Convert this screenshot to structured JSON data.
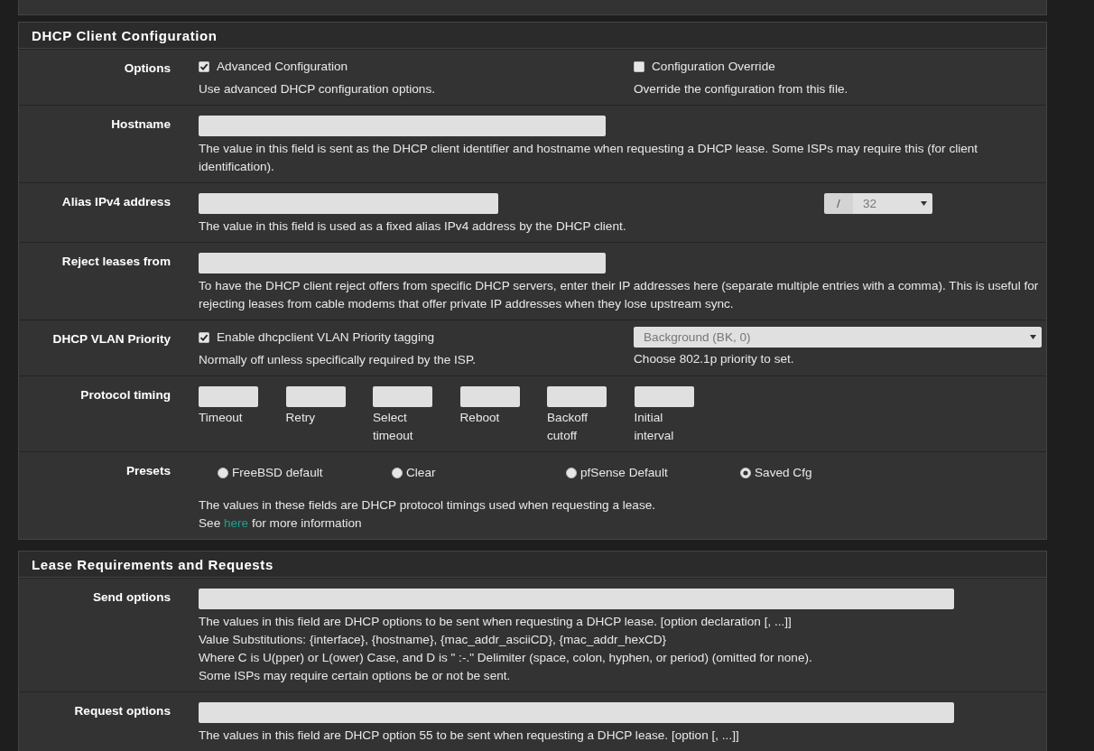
{
  "sections": [
    {
      "title": "DHCP Client Configuration",
      "rows": [
        {
          "kind": "options",
          "label": "Options",
          "checks": [
            {
              "label": "Advanced Configuration",
              "checked": true,
              "help": "Use advanced DHCP configuration options."
            },
            {
              "label": "Configuration Override",
              "checked": false,
              "help": "Override the configuration from this file."
            }
          ]
        },
        {
          "kind": "text",
          "label": "Hostname",
          "help": [
            "The value in this field is sent as the DHCP client identifier and hostname when requesting a DHCP lease. Some ISPs may require this (for client identification)."
          ]
        },
        {
          "kind": "address",
          "label": "Alias IPv4 address",
          "separator": "/",
          "cidr": "32",
          "help": [
            "The value in this field is used as a fixed alias IPv4 address by the DHCP client."
          ]
        },
        {
          "kind": "text",
          "label": "Reject leases from",
          "help": [
            "To have the DHCP client reject offers from specific DHCP servers, enter their IP addresses here (separate multiple entries with a comma). This is useful for rejecting leases from cable modems that offer private IP addresses when they lose upstream sync."
          ]
        },
        {
          "kind": "priority",
          "label": "DHCP VLAN Priority",
          "check": {
            "label": "Enable dhcpclient VLAN Priority tagging",
            "checked": true
          },
          "check_help": "Normally off unless specifically required by the ISP.",
          "select": "Background (BK, 0)",
          "select_help": "Choose 802.1p priority to set."
        },
        {
          "kind": "timing",
          "label": "Protocol timing",
          "fields": [
            "Timeout",
            "Retry",
            "Select timeout",
            "Reboot",
            "Backoff cutoff",
            "Initial interval"
          ]
        },
        {
          "kind": "presets",
          "label": "Presets",
          "options": [
            {
              "label": "FreeBSD default",
              "selected": false
            },
            {
              "label": "Clear",
              "selected": false
            },
            {
              "label": "pfSense Default",
              "selected": false
            },
            {
              "label": "Saved Cfg",
              "selected": true
            }
          ],
          "help": [
            "The values in these fields are DHCP protocol timings used when requesting a lease."
          ],
          "link_line": {
            "before": "See ",
            "link": "here",
            "after": " for more information"
          }
        }
      ]
    },
    {
      "title": "Lease Requirements and Requests",
      "rows": [
        {
          "kind": "long_text",
          "label": "Send options",
          "help": [
            "The values in this field are DHCP options to be sent when requesting a DHCP lease. [option declaration [, ...]]",
            "Value Substitutions: {interface}, {hostname}, {mac_addr_asciiCD}, {mac_addr_hexCD}",
            "Where C is U(pper) or L(ower) Case, and D is \" :-.\" Delimiter (space, colon, hyphen, or period) (omitted for none).",
            "Some ISPs may require certain options be or not be sent."
          ]
        },
        {
          "kind": "long_text",
          "label": "Request options",
          "help": [
            "The values in this field are DHCP option 55 to be sent when requesting a DHCP lease. [option [, ...]]"
          ]
        }
      ]
    }
  ]
}
